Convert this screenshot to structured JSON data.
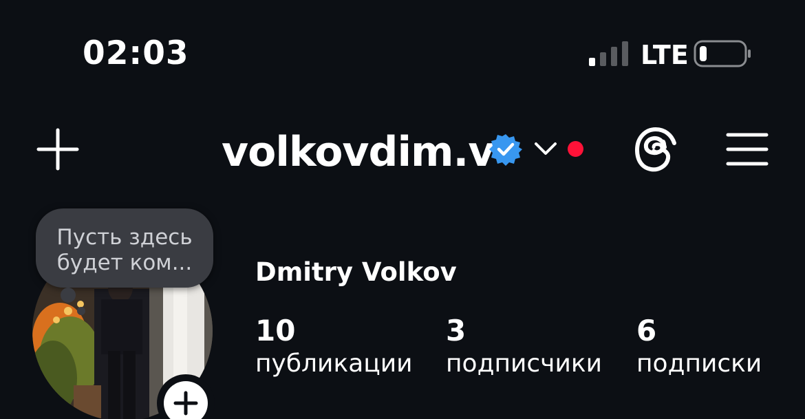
{
  "status_bar": {
    "time": "02:03",
    "network": "LTE",
    "signal_bars_active": 1,
    "battery_level": 0.15
  },
  "header": {
    "username": "volkovdim.v",
    "verified": true,
    "verified_color": "#3897f0",
    "notification_dot_color": "#ff1238",
    "icons": [
      "plus-icon",
      "verified-badge-icon",
      "chevron-down-icon",
      "threads-icon",
      "menu-icon"
    ]
  },
  "profile": {
    "note": "Пусть здесь будет ком...",
    "full_name": "Dmitry Volkov",
    "stats": [
      {
        "value": "10",
        "label": "публикации"
      },
      {
        "value": "3",
        "label": "подписчики"
      },
      {
        "value": "6",
        "label": "подписки"
      }
    ]
  },
  "colors": {
    "background": "#0c0f14",
    "text": "#ffffff",
    "note_bubble": "#3a3c42"
  }
}
